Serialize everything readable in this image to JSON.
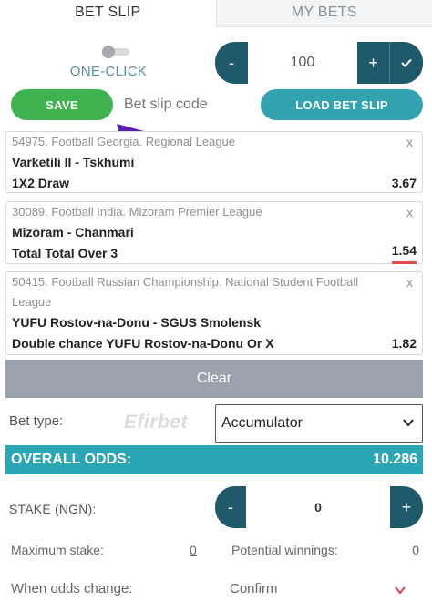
{
  "tabs": [
    {
      "label": "BET SLIP",
      "active": true
    },
    {
      "label": "MY BETS",
      "active": false
    }
  ],
  "one_click": {
    "label": "ONE-CLICK",
    "enabled": false
  },
  "top_stepper": {
    "minus": "-",
    "value": "100",
    "plus": "+",
    "confirm_icon": "check-icon"
  },
  "actions": {
    "save_label": "SAVE",
    "code_placeholder": "Bet slip code",
    "load_label": "LOAD BET SLIP"
  },
  "bets": [
    {
      "league": "54975. Football Georgia. Regional League",
      "match": "Varketili II - Tskhumi",
      "market": "1X2 Draw",
      "odds": "3.67",
      "close": "x"
    },
    {
      "league": "30089. Football India. Mizoram Premier League",
      "match": "Mizoram - Chanmari",
      "market": "Total Total Over 3",
      "odds": "1.54",
      "close": "x"
    },
    {
      "league": "50415. Football Russian Championship. National Student Football League",
      "match": "YUFU Rostov-na-Donu - SGUS Smolensk",
      "market": "Double chance YUFU Rostov-na-Donu Or X",
      "odds": "1.82",
      "close": "x"
    }
  ],
  "clear_label": "Clear",
  "bet_type": {
    "label": "Bet type:",
    "watermark": "Efirbet",
    "selected": "Accumulator"
  },
  "overall": {
    "label": "OVERALL ODDS:",
    "value": "10.286"
  },
  "stake": {
    "label": "STAKE (NGN):",
    "minus": "-",
    "value": "0",
    "plus": "+"
  },
  "limits": {
    "max_label": "Maximum stake:",
    "max_value": "0",
    "potential_label": "Potential winnings:",
    "potential_value": "0"
  },
  "odds_change": {
    "label": "When odds change:",
    "value": "Confirm"
  },
  "colors": {
    "accent_dark": "#1f5a6a",
    "teal": "#2aa6b4",
    "save_green": "#3fb34f",
    "arrow_purple": "#5b1fb0",
    "changed_red": "#e34a4a"
  }
}
